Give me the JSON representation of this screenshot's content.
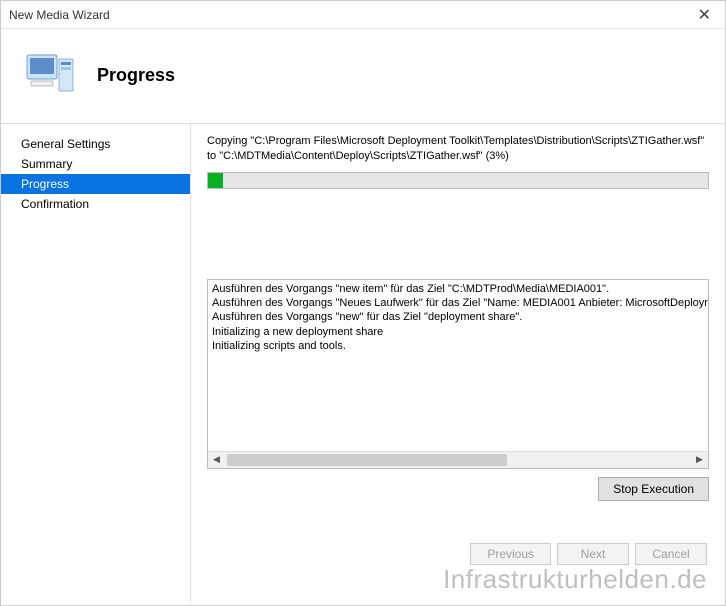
{
  "window": {
    "title": "New Media Wizard",
    "close_label": "✕"
  },
  "header": {
    "title": "Progress"
  },
  "sidebar": {
    "items": [
      {
        "label": "General Settings",
        "selected": false
      },
      {
        "label": "Summary",
        "selected": false
      },
      {
        "label": "Progress",
        "selected": true
      },
      {
        "label": "Confirmation",
        "selected": false
      }
    ]
  },
  "progress": {
    "status_line1": "Copying \"C:\\Program Files\\Microsoft Deployment Toolkit\\Templates\\Distribution\\Scripts\\ZTIGather.wsf\"",
    "status_line2": "to \"C:\\MDTMedia\\Content\\Deploy\\Scripts\\ZTIGather.wsf\" (3%)",
    "percent": 3,
    "log_lines": [
      "Ausführen des Vorgangs \"new item\" für das Ziel \"C:\\MDTProd\\Media\\MEDIA001\".",
      "Ausführen des Vorgangs \"Neues Laufwerk\" für das Ziel \"Name: MEDIA001 Anbieter: MicrosoftDeployme",
      "Ausführen des Vorgangs \"new\" für das Ziel \"deployment share\".",
      "Initializing a new deployment share",
      "Initializing scripts and tools."
    ],
    "stop_button_label": "Stop Execution"
  },
  "footer": {
    "previous_label": "Previous",
    "next_label": "Next",
    "cancel_label": "Cancel"
  },
  "watermark": "Infrastrukturhelden.de"
}
